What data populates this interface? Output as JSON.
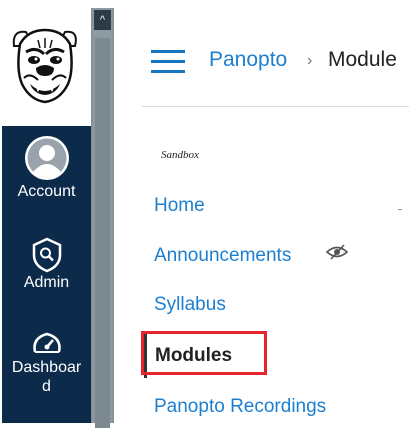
{
  "colors": {
    "nav_background": "#0c2a4a",
    "link": "#1c7fd0",
    "highlight_box": "#e5242b",
    "scrollbar": "#87939b"
  },
  "global_nav": {
    "logo": "bulldog-logo",
    "items": [
      {
        "label": "Account",
        "icon": "account-avatar-icon"
      },
      {
        "label": "Admin",
        "icon": "admin-shield-icon"
      },
      {
        "label": "Dashboar d",
        "icon": "dashboard-gauge-icon"
      }
    ]
  },
  "header": {
    "menu_icon": "hamburger-icon",
    "breadcrumb": [
      "Panopto",
      "Module"
    ],
    "separator": "›"
  },
  "course_nav": {
    "subtitle": "Sandbox",
    "items": [
      {
        "label": "Home"
      },
      {
        "label": "Announcements",
        "hidden_icon": "eye-slash-icon"
      },
      {
        "label": "Syllabus"
      },
      {
        "label": "Modules",
        "active": true,
        "highlighted": true
      },
      {
        "label": "Panopto Recordings"
      }
    ]
  }
}
